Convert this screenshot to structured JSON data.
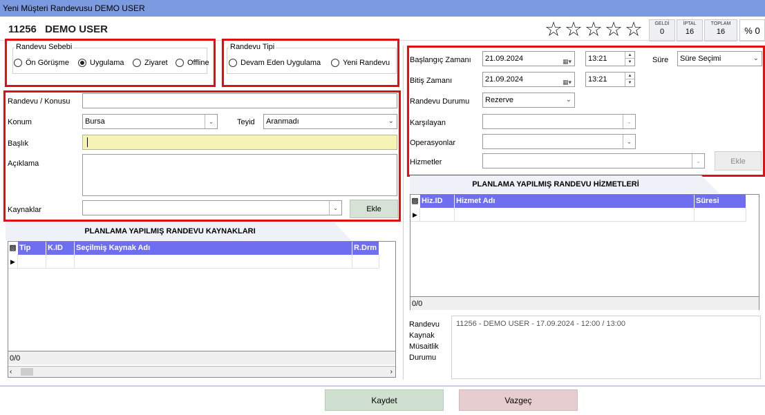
{
  "window": {
    "title": "Yeni Müşteri Randevusu DEMO USER"
  },
  "header": {
    "customer_id": "11256",
    "customer_name": "DEMO USER",
    "stars": [
      "☆",
      "☆",
      "☆",
      "☆",
      "☆"
    ],
    "stats": [
      {
        "label": "GELDİ",
        "value": "0"
      },
      {
        "label": "İPTAL",
        "value": "16"
      },
      {
        "label": "TOPLAM",
        "value": "16"
      }
    ],
    "percent": "% 0"
  },
  "reason": {
    "legend": "Randevu Sebebi",
    "options": [
      "Ön Görüşme",
      "Uygulama",
      "Ziyaret",
      "Offline"
    ],
    "selected": "Uygulama"
  },
  "type": {
    "legend": "Randevu Tipi",
    "options": [
      "Devam Eden Uygulama",
      "Yeni Randevu"
    ]
  },
  "form": {
    "subject_label": "Randevu / Konusu",
    "subject_value": "",
    "location_label": "Konum",
    "location_value": "Bursa",
    "confirm_label": "Teyid",
    "confirm_value": "Aranmadı",
    "title_label": "Başlık",
    "title_value": "",
    "desc_label": "Açıklama",
    "desc_value": "",
    "resources_label": "Kaynaklar",
    "resources_value": "",
    "add_label": "Ekle"
  },
  "resources_grid": {
    "title": "PLANLAMA YAPILMIŞ RANDEVU KAYNAKLARI",
    "columns": [
      "Tip",
      "K.ID",
      "Seçilmiş Kaynak Adı",
      "R.Drm"
    ],
    "footer": "0/0"
  },
  "schedule": {
    "start_label": "Başlangıç Zamanı",
    "start_date": "21.09.2024",
    "start_time": "13:21",
    "duration_label": "Süre",
    "duration_value": "Süre Seçimi",
    "end_label": "Bitiş Zamanı",
    "end_date": "21.09.2024",
    "end_time": "13:21",
    "status_label": "Randevu Durumu",
    "status_value": "Rezerve",
    "greeter_label": "Karşılayan",
    "greeter_value": "",
    "operations_label": "Operasyonlar",
    "operations_value": "",
    "services_label": "Hizmetler",
    "services_value": "",
    "add_label": "Ekle"
  },
  "services_grid": {
    "title": "PLANLAMA YAPILMIŞ RANDEVU HİZMETLERİ",
    "columns": [
      "Hiz.ID",
      "Hizmet Adı",
      "Süresi"
    ],
    "footer": "0/0"
  },
  "availability": {
    "label_lines": [
      "Randevu",
      "Kaynak",
      "Müsaitlik",
      "Durumu"
    ],
    "text": "11256 - DEMO USER - 17.09.2024 - 12:00 / 13:00"
  },
  "actions": {
    "save": "Kaydet",
    "cancel": "Vazgeç"
  },
  "colors": {
    "titlebar": "#7b9ae0",
    "grid_header": "#6e6ef0",
    "highlight_box": "#e01010",
    "title_input_bg": "#f6f4b4"
  }
}
